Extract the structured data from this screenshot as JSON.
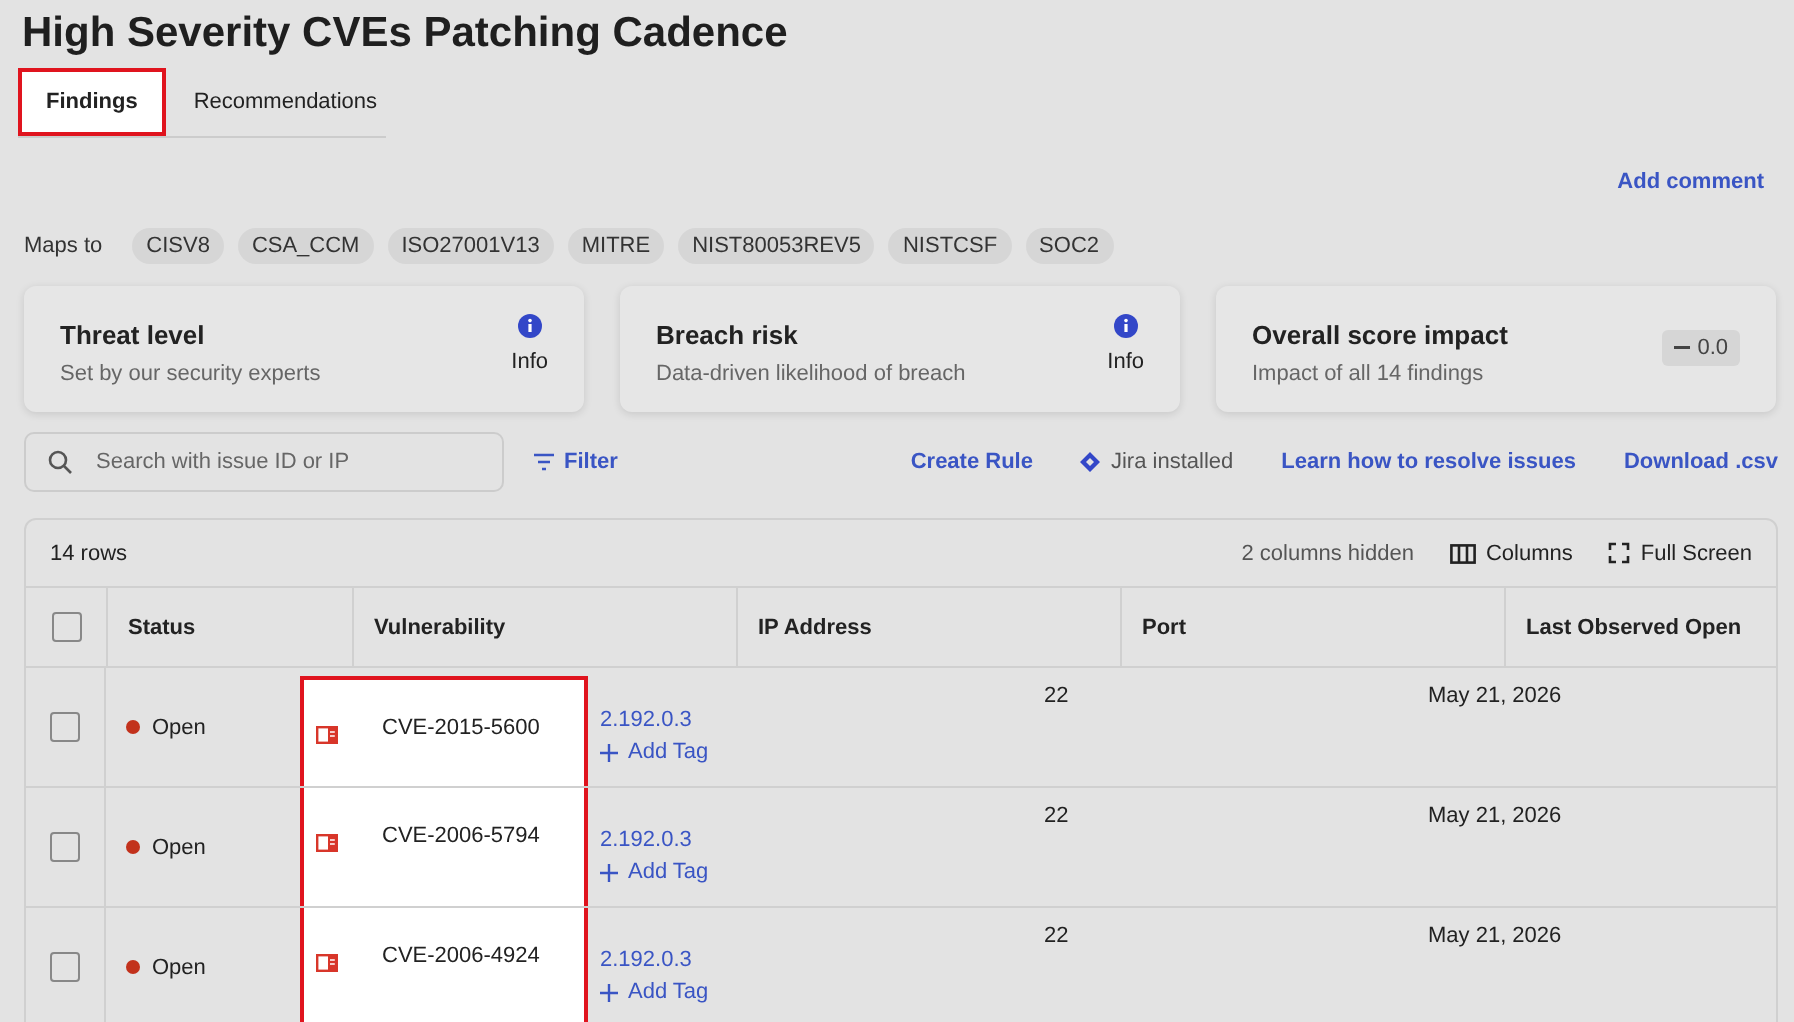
{
  "title": "High Severity CVEs Patching Cadence",
  "tabs": [
    {
      "label": "Findings",
      "selected": true,
      "highlighted": true
    },
    {
      "label": "Recommendations",
      "selected": false,
      "highlighted": false
    }
  ],
  "add_comment": "Add comment",
  "maps_to": {
    "label": "Maps to",
    "tags": [
      "CISV8",
      "CSA_CCM",
      "ISO27001V13",
      "MITRE",
      "NIST80053REV5",
      "NISTCSF",
      "SOC2"
    ]
  },
  "cards": [
    {
      "kind": "info",
      "title": "Threat level",
      "subtitle": "Set by our security experts",
      "value": "Info"
    },
    {
      "kind": "info",
      "title": "Breach risk",
      "subtitle": "Data-driven likelihood of breach",
      "value": "Info"
    },
    {
      "kind": "score",
      "title": "Overall score impact",
      "subtitle": "Impact of all 14 findings",
      "value": "0.0"
    }
  ],
  "search": {
    "placeholder": "Search with issue ID or IP"
  },
  "filter": "Filter",
  "actions": [
    {
      "kind": "link",
      "label": "Create Rule"
    },
    {
      "kind": "status",
      "label": "Jira installed"
    },
    {
      "kind": "link",
      "label": "Learn how to resolve issues"
    },
    {
      "kind": "link",
      "label": "Download .csv"
    }
  ],
  "table": {
    "row_count": "14 rows",
    "hidden_columns": "2 columns hidden",
    "columns_button": "Columns",
    "fullscreen_button": "Full Screen",
    "columns": [
      "Status",
      "Vulnerability",
      "IP Address",
      "Port",
      "Last Observed Open"
    ],
    "vulnerability_highlighted": true,
    "select_all_checked": false,
    "rows": [
      {
        "checked": false,
        "status": "Open",
        "vulnerability": "CVE-2015-5600",
        "ip": "2.192.0.3",
        "add_tag": "Add Tag",
        "port": "22",
        "last_observed": "May 21, 2026"
      },
      {
        "checked": false,
        "status": "Open",
        "vulnerability": "CVE-2006-5794",
        "ip": "2.192.0.3",
        "add_tag": "Add Tag",
        "port": "22",
        "last_observed": "May 21, 2026"
      },
      {
        "checked": false,
        "status": "Open",
        "vulnerability": "CVE-2006-4924",
        "ip": "2.192.0.3",
        "add_tag": "Add Tag",
        "port": "22",
        "last_observed": "May 21, 2026"
      }
    ]
  }
}
